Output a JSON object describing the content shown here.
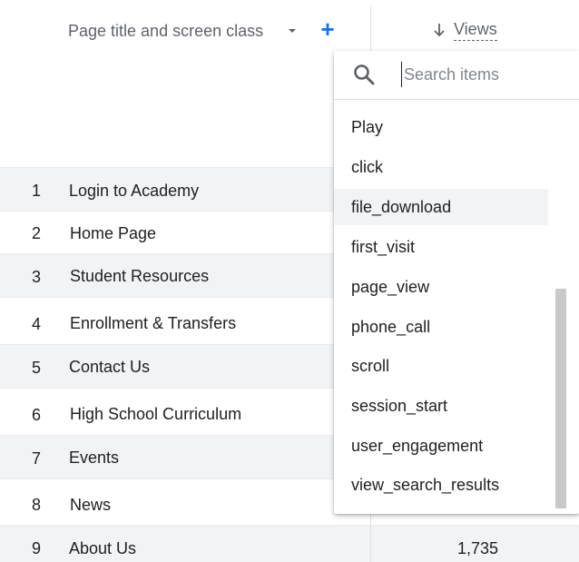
{
  "header": {
    "dimension_label": "Page title and screen class",
    "add_dimension_symbol": "+",
    "metric_label": "Views",
    "sort_arrow": "↓"
  },
  "rows": [
    {
      "index": "1",
      "title": "Login to Academy",
      "views": ""
    },
    {
      "index": "2",
      "title": "Home Page",
      "views": ""
    },
    {
      "index": "3",
      "title": "Student Resources",
      "views": ""
    },
    {
      "index": "4",
      "title": "Enrollment & Transfers",
      "views": ""
    },
    {
      "index": "5",
      "title": "Contact Us",
      "views": ""
    },
    {
      "index": "6",
      "title": "High School Curriculum",
      "views": ""
    },
    {
      "index": "7",
      "title": "Events",
      "views": ""
    },
    {
      "index": "8",
      "title": "News",
      "views": ""
    },
    {
      "index": "9",
      "title": "About Us",
      "views": "1,735"
    }
  ],
  "search": {
    "placeholder": "Search items",
    "value": ""
  },
  "menu": {
    "items": [
      "Play",
      "click",
      "file_download",
      "first_visit",
      "page_view",
      "phone_call",
      "scroll",
      "session_start",
      "user_engagement",
      "view_search_results"
    ],
    "highlighted": "file_download"
  },
  "colors": {
    "accent": "#1a73e8",
    "row_shade": "#f1f3f5",
    "highlight": "#f1f3f4"
  },
  "icons": {
    "search": "search-icon",
    "dropdown": "arrow-drop-down-icon",
    "sort": "arrow-down-icon"
  }
}
